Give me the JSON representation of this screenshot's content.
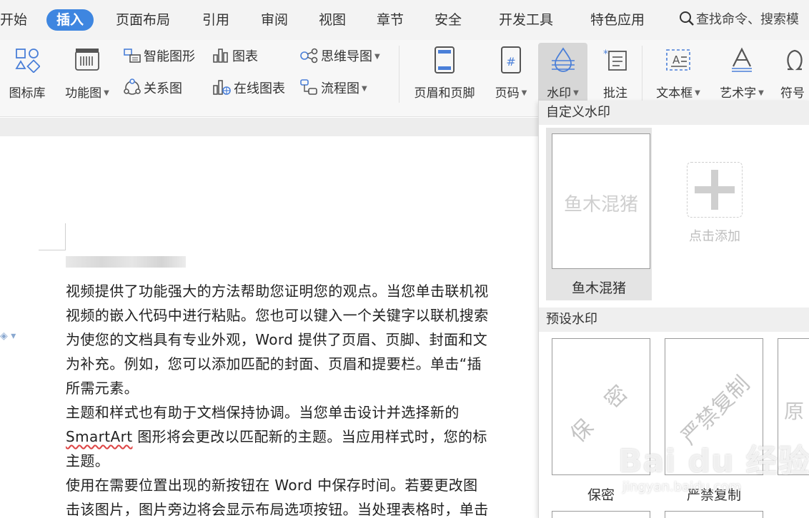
{
  "tabs": [
    {
      "label": "开始"
    },
    {
      "label": "插入",
      "active": true
    },
    {
      "label": "页面布局"
    },
    {
      "label": "引用"
    },
    {
      "label": "审阅"
    },
    {
      "label": "视图"
    },
    {
      "label": "章节"
    },
    {
      "label": "安全"
    },
    {
      "label": "开发工具"
    },
    {
      "label": "特色应用"
    }
  ],
  "search": {
    "label": "查找命令、搜索模"
  },
  "ribbon": {
    "icon_library": "图标库",
    "function_chart": "功能图",
    "smart_shape": "智能图形",
    "chart": "图表",
    "mind_map": "思维导图",
    "relation_chart": "关系图",
    "online_chart": "在线图表",
    "flowchart": "流程图",
    "header_footer": "页眉和页脚",
    "page_number": "页码",
    "watermark": "水印",
    "comment": "批注",
    "text_box": "文本框",
    "word_art": "艺术字",
    "symbol": "符号"
  },
  "document": {
    "lines": [
      "视频提供了功能强大的方法帮助您证明您的观点。当您单击联机视",
      "视频的嵌入代码中进行粘贴。您也可以键入一个关键字以联机搜索",
      "为使您的文档具有专业外观，Word 提供了页眉、页脚、封面和文",
      "为补充。例如，您可以添加匹配的封面、页眉和提要栏。单击“插",
      "所需元素。",
      "主题和样式也有助于文档保持协调。当您单击设计并选择新的",
      " 图形将会更改以匹配新的主题。当应用样式时，您的标",
      "主题。",
      "使用在需要位置出现的新按钮在 Word 中保存时间。若要更改图",
      "击该图片，图片旁边将会显示布局选项按钮。当处理表格时，单击"
    ],
    "smartart_word": "SmartArt"
  },
  "watermark_panel": {
    "custom_header": "自定义水印",
    "custom_items": [
      {
        "preview_text": "鱼木混猪",
        "label": "鱼木混猪"
      }
    ],
    "add_label": "点击添加",
    "preset_header": "预设水印",
    "presets": [
      {
        "preview_text": "保 密",
        "label": "保密"
      },
      {
        "preview_text": "严禁复制",
        "label": "严禁复制"
      },
      {
        "preview_text": "原"
      }
    ]
  },
  "site_watermark": {
    "logo": "Bai du 经验",
    "url": "jingyan.baidu.com"
  }
}
